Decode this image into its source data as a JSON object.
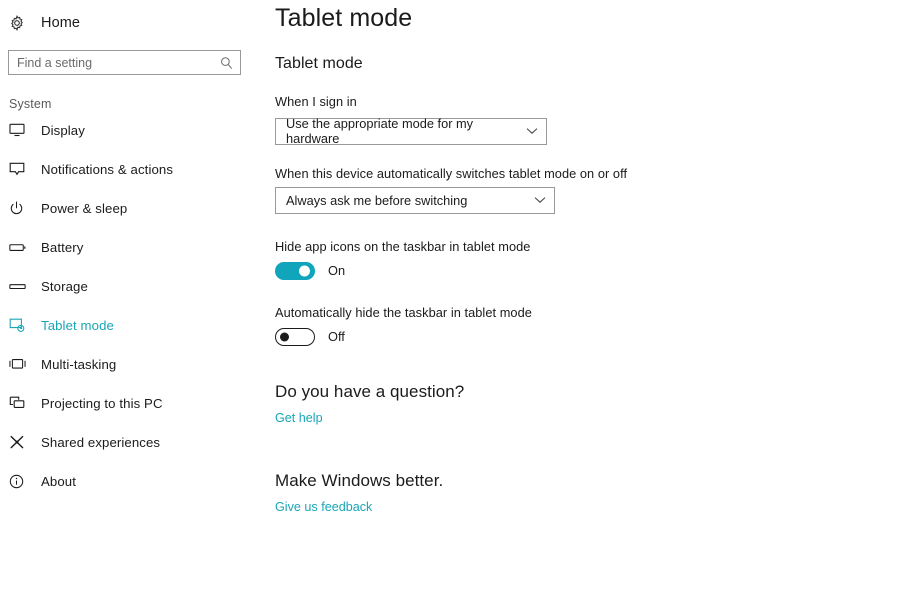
{
  "sidebar": {
    "home": {
      "label": "Home",
      "icon": "gear-icon"
    },
    "search": {
      "value": "",
      "placeholder": "Find a setting",
      "icon": "search-icon"
    },
    "group_label": "System",
    "items": [
      {
        "label": "Display",
        "icon": "monitor-icon",
        "active": false
      },
      {
        "label": "Notifications & actions",
        "icon": "notification-icon",
        "active": false
      },
      {
        "label": "Power & sleep",
        "icon": "power-icon",
        "active": false
      },
      {
        "label": "Battery",
        "icon": "battery-icon",
        "active": false
      },
      {
        "label": "Storage",
        "icon": "storage-icon",
        "active": false
      },
      {
        "label": "Tablet mode",
        "icon": "tablet-mode-icon",
        "active": true
      },
      {
        "label": "Multi-tasking",
        "icon": "multitasking-icon",
        "active": false
      },
      {
        "label": "Projecting to this PC",
        "icon": "projecting-icon",
        "active": false
      },
      {
        "label": "Shared experiences",
        "icon": "shared-experiences-icon",
        "active": false
      },
      {
        "label": "About",
        "icon": "info-icon",
        "active": false
      }
    ]
  },
  "main": {
    "page_title": "Tablet mode",
    "section_title": "Tablet mode",
    "sign_in": {
      "label": "When I sign in",
      "selected": "Use the appropriate mode for my hardware"
    },
    "auto_switch": {
      "label": "When this device automatically switches tablet mode on or off",
      "selected": "Always ask me before switching"
    },
    "hide_app_icons": {
      "label": "Hide app icons on the taskbar in tablet mode",
      "state": "On",
      "on": true
    },
    "auto_hide_taskbar": {
      "label": "Automatically hide the taskbar in tablet mode",
      "state": "Off",
      "on": false
    },
    "question_block": {
      "heading": "Do you have a question?",
      "link": "Get help"
    },
    "feedback_block": {
      "heading": "Make Windows better.",
      "link": "Give us feedback"
    }
  },
  "colors": {
    "accent": "#1aa6b7",
    "toggle_on": "#10a5ba",
    "text": "#1b1b1b",
    "muted_text": "#5a5a5a",
    "border": "#999999",
    "background": "#ffffff"
  }
}
